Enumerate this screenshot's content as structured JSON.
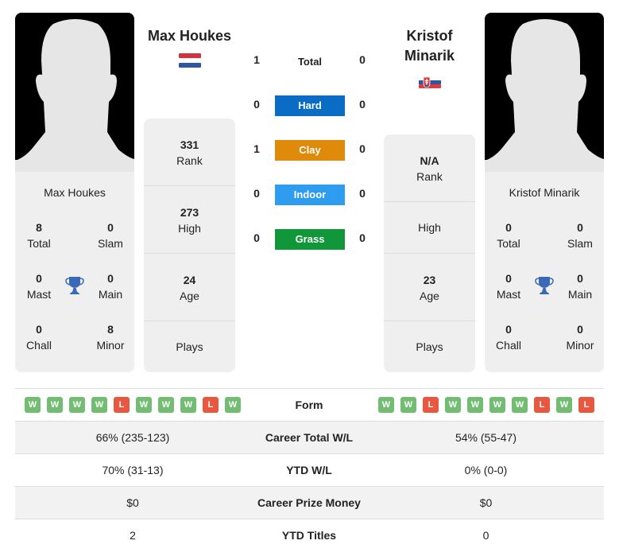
{
  "colors": {
    "hard": "#0a6cc4",
    "clay": "#e08a0b",
    "indoor": "#2e9df0",
    "grass": "#11973a",
    "win": "#72bd72",
    "loss": "#e8573f",
    "trophy": "#3a6ab7"
  },
  "player1": {
    "name": "Max Houkes",
    "card_name": "Max Houkes",
    "flag": "netherlands-flag",
    "rank": "331",
    "rank_label": "Rank",
    "high": "273",
    "high_label": "High",
    "age": "24",
    "age_label": "Age",
    "plays_label": "Plays",
    "titles": {
      "total": "8",
      "total_label": "Total",
      "slam": "0",
      "slam_label": "Slam",
      "mast": "0",
      "mast_label": "Mast",
      "main": "0",
      "main_label": "Main",
      "chall": "0",
      "chall_label": "Chall",
      "minor": "8",
      "minor_label": "Minor"
    },
    "form": [
      "W",
      "W",
      "W",
      "W",
      "L",
      "W",
      "W",
      "W",
      "L",
      "W"
    ]
  },
  "player2": {
    "name": "Kristof Minarik",
    "name_line1": "Kristof",
    "name_line2": "Minarik",
    "card_name": "Kristof Minarik",
    "flag": "slovakia-flag",
    "rank": "N/A",
    "rank_label": "Rank",
    "high_label": "High",
    "age": "23",
    "age_label": "Age",
    "plays_label": "Plays",
    "titles": {
      "total": "0",
      "total_label": "Total",
      "slam": "0",
      "slam_label": "Slam",
      "mast": "0",
      "mast_label": "Mast",
      "main": "0",
      "main_label": "Main",
      "chall": "0",
      "chall_label": "Chall",
      "minor": "0",
      "minor_label": "Minor"
    },
    "form": [
      "W",
      "W",
      "L",
      "W",
      "W",
      "W",
      "W",
      "L",
      "W",
      "L"
    ]
  },
  "h2h": {
    "total": {
      "label": "Total",
      "p1": "1",
      "p2": "0"
    },
    "surfaces": [
      {
        "label": "Hard",
        "p1": "0",
        "p2": "0",
        "color_key": "hard"
      },
      {
        "label": "Clay",
        "p1": "1",
        "p2": "0",
        "color_key": "clay"
      },
      {
        "label": "Indoor",
        "p1": "0",
        "p2": "0",
        "color_key": "indoor"
      },
      {
        "label": "Grass",
        "p1": "0",
        "p2": "0",
        "color_key": "grass"
      }
    ]
  },
  "table": {
    "form_label": "Form",
    "rows": [
      {
        "label": "Career Total W/L",
        "p1": "66% (235-123)",
        "p2": "54% (55-47)"
      },
      {
        "label": "YTD W/L",
        "p1": "70% (31-13)",
        "p2": "0% (0-0)"
      },
      {
        "label": "Career Prize Money",
        "p1": "$0",
        "p2": "$0"
      },
      {
        "label": "YTD Titles",
        "p1": "2",
        "p2": "0"
      }
    ]
  }
}
